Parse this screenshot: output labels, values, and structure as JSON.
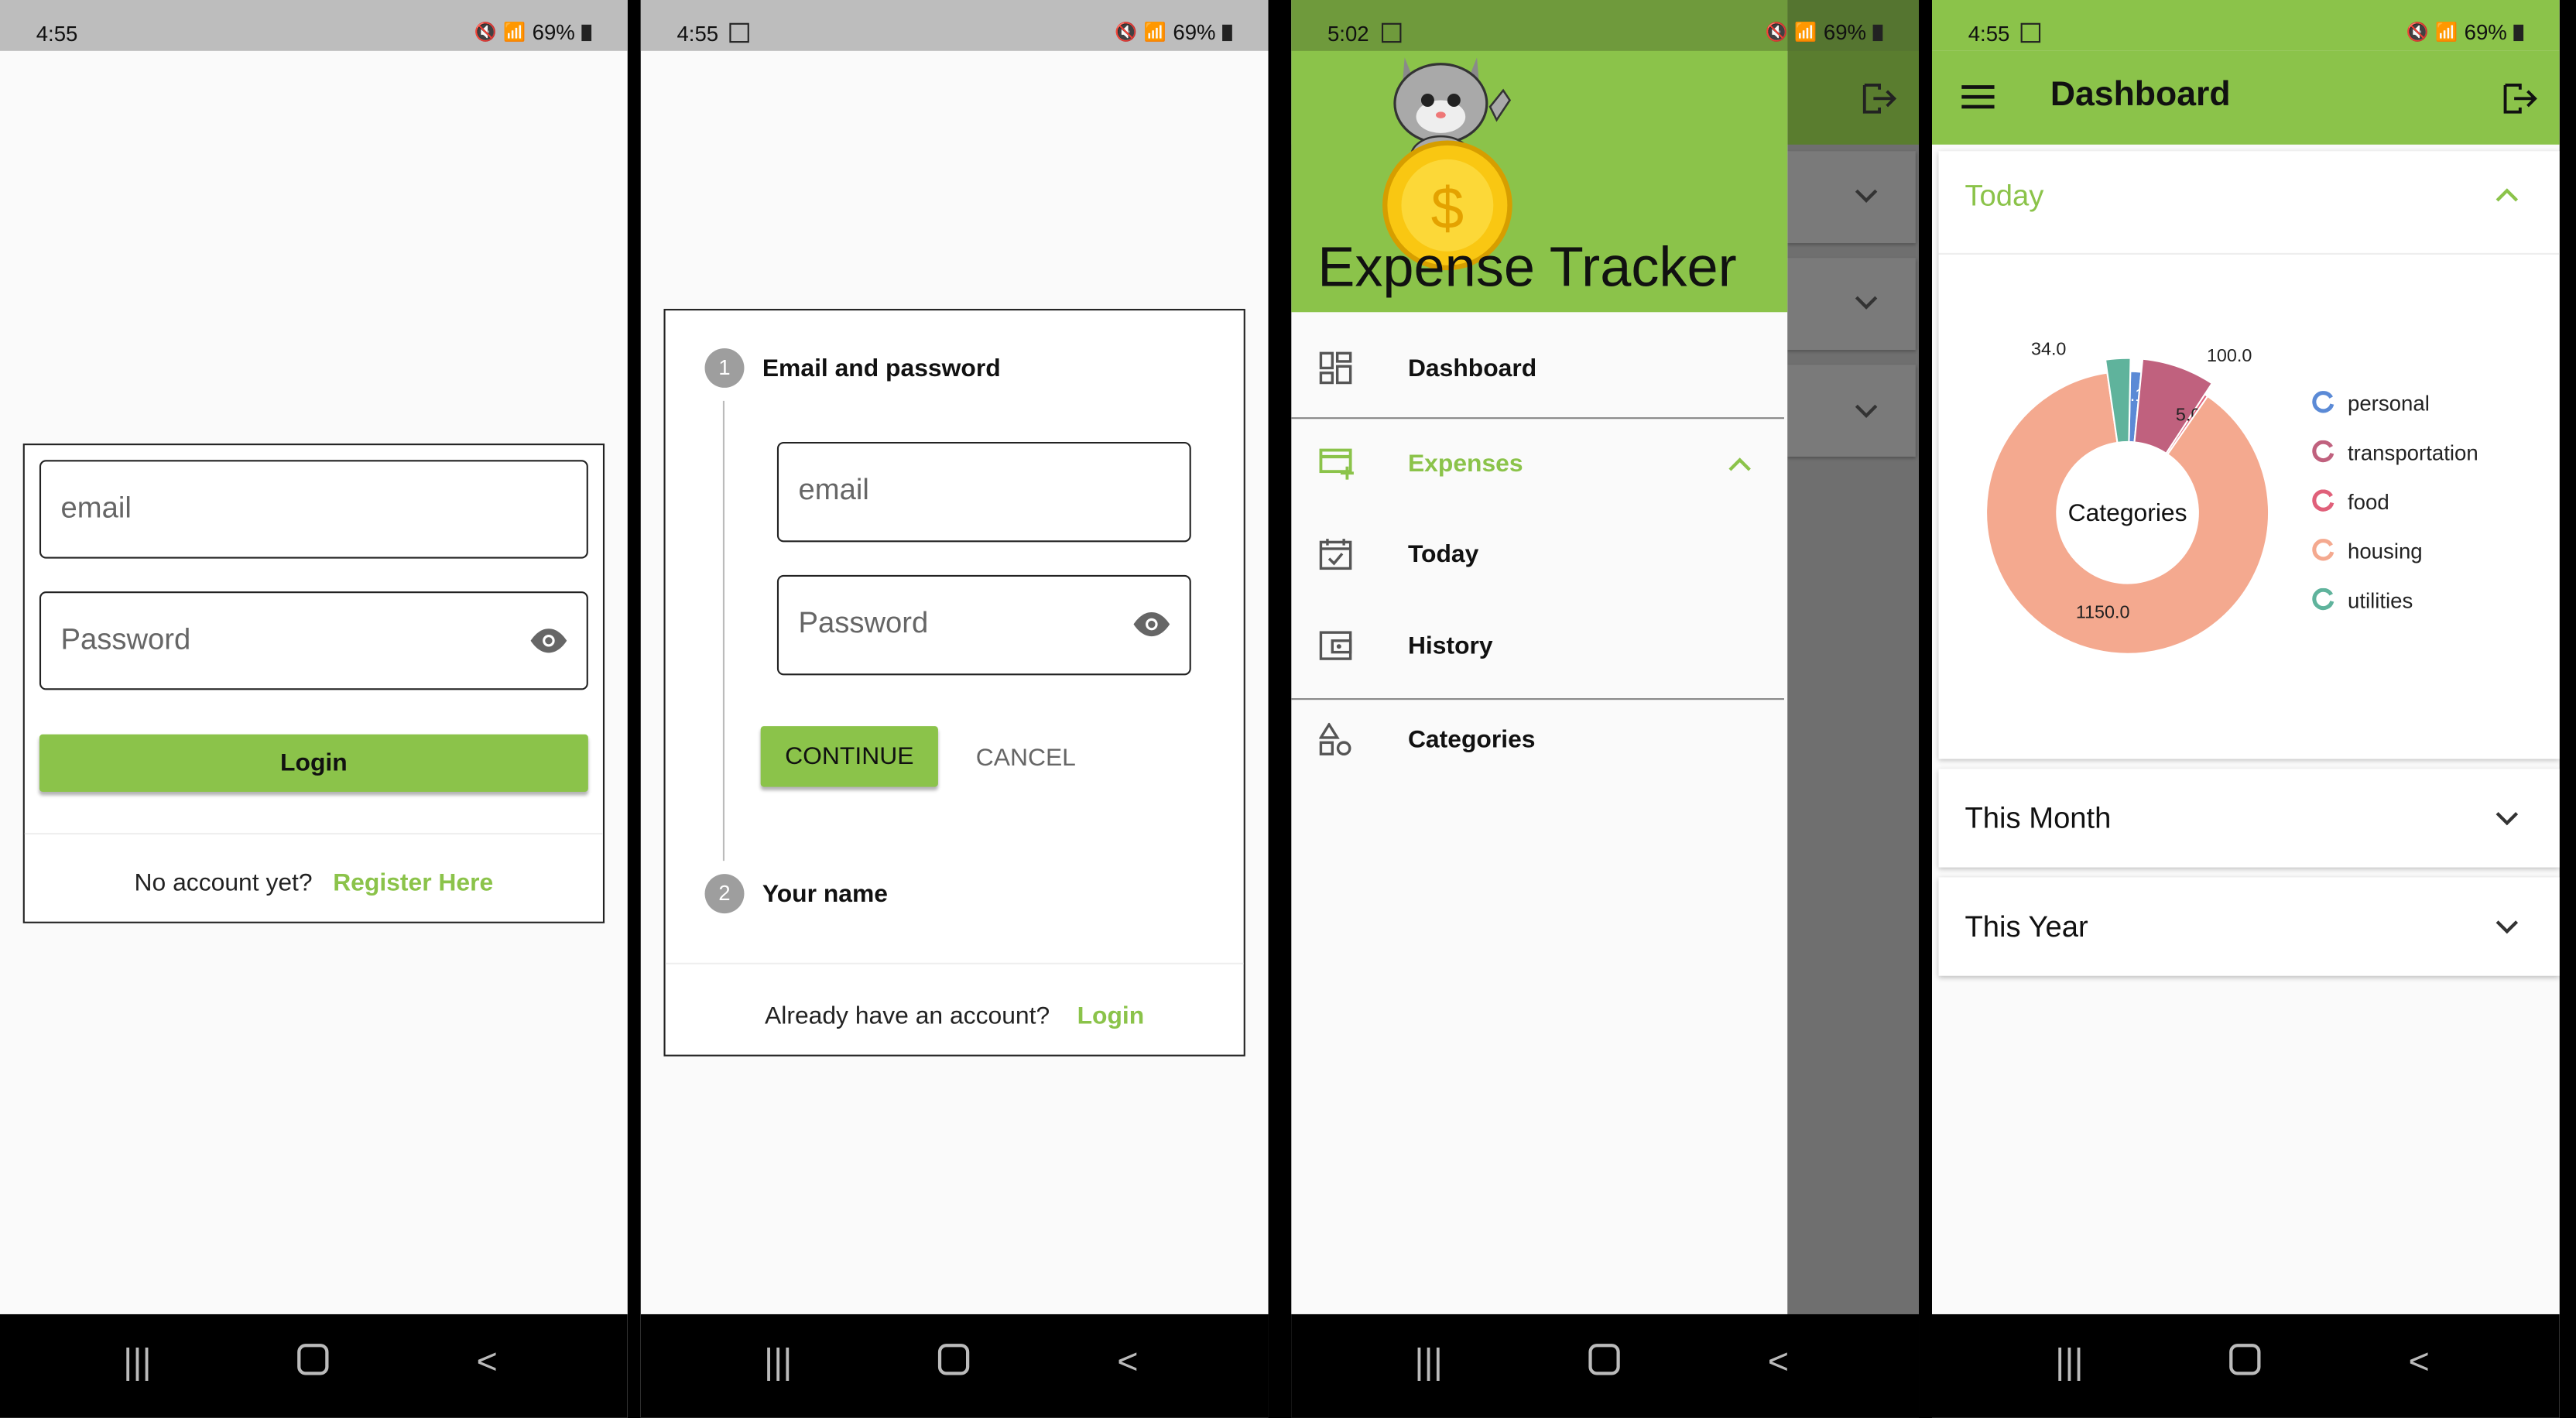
{
  "status": {
    "p1_time": "4:55",
    "p2_time": "4:55",
    "p3_time": "5:02",
    "p4_time": "4:55",
    "battery": "69%"
  },
  "login": {
    "email_placeholder": "email",
    "password_placeholder": "Password",
    "login_button": "Login",
    "no_account": "No account yet?",
    "register_link": "Register Here"
  },
  "register": {
    "step1_number": "1",
    "step1_title": "Email and password",
    "email_placeholder": "email",
    "password_placeholder": "Password",
    "continue_button": "CONTINUE",
    "cancel_button": "CANCEL",
    "step2_number": "2",
    "step2_title": "Your name",
    "have_account": "Already have an account?",
    "login_link": "Login"
  },
  "drawer": {
    "app_title": "Expense Tracker",
    "items": {
      "dashboard": "Dashboard",
      "expenses": "Expenses",
      "today": "Today",
      "history": "History",
      "categories": "Categories"
    }
  },
  "dashboard": {
    "title": "Dashboard",
    "today": "Today",
    "this_month": "This Month",
    "this_year": "This Year"
  },
  "chart_data": {
    "type": "pie",
    "title": "Categories",
    "categories": [
      "personal",
      "transportation",
      "food",
      "housing",
      "utilities"
    ],
    "values": [
      16.19,
      100.0,
      5.0,
      1150.0,
      34.0
    ],
    "labels": [
      "16.19",
      "100.0",
      "5.0",
      "1150.0",
      "34.0"
    ],
    "colors": [
      "#5b8ad6",
      "#c0617e",
      "#e0607a",
      "#f4a98f",
      "#5fb39c"
    ],
    "legend_placement": "right"
  },
  "colors": {
    "accent": "#8bc34a",
    "scrim": "#6f6f6f"
  }
}
